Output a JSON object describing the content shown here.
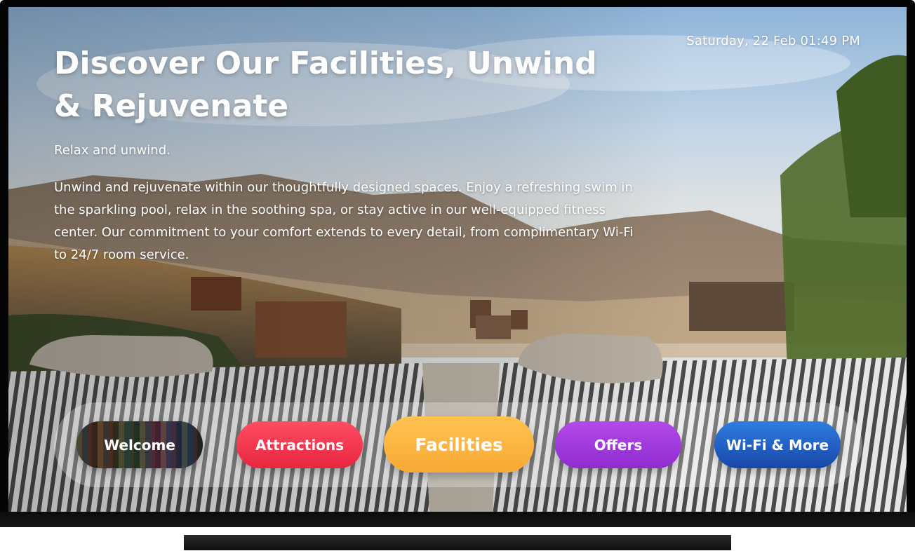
{
  "screen": {
    "datetime": "Saturday, 22 Feb 01:49 PM",
    "title": "Discover Our Facilities, Unwind & Rejuvenate",
    "subtitle": "Relax and unwind.",
    "description": "Unwind and rejuvenate within our thoughtfully designed spaces. Enjoy a refreshing swim in the sparkling pool, relax in the soothing spa, or stay active in our well-equipped fitness center. Our commitment to your comfort extends to every detail, from complimentary Wi-Fi to 24/7 room service."
  },
  "nav": {
    "items": [
      {
        "label": "Welcome"
      },
      {
        "label": "Attractions"
      },
      {
        "label": "Facilities"
      },
      {
        "label": "Offers"
      },
      {
        "label": "Wi-Fi & More"
      }
    ],
    "active": "Facilities"
  },
  "colors": {
    "attractions": "#e8263f",
    "facilities": "#f9a935",
    "offers": "#8e2bd0",
    "wifi": "#1747a8"
  }
}
